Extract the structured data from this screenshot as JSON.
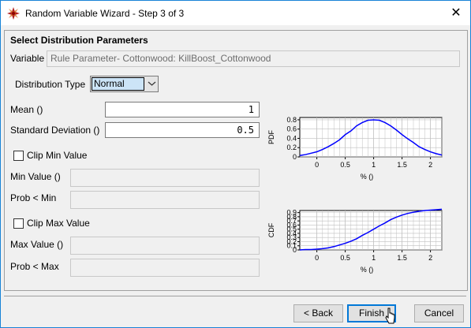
{
  "window": {
    "title": "Random Variable Wizard - Step 3 of 3",
    "close_glyph": "✕"
  },
  "section_title": "Select Distribution Parameters",
  "variable": {
    "label": "Variable",
    "value": "Rule Parameter- Cottonwood: KillBoost_Cottonwood"
  },
  "distribution_type": {
    "label": "Distribution Type",
    "selected": "Normal"
  },
  "mean": {
    "label": "Mean ()",
    "value": "1"
  },
  "std_dev": {
    "label": "Standard Deviation ()",
    "value": "0.5"
  },
  "clip_min": {
    "label": "Clip Min Value",
    "checked": false,
    "min_value_label": "Min Value ()",
    "prob_label": "Prob < Min"
  },
  "clip_max": {
    "label": "Clip Max Value",
    "checked": false,
    "max_value_label": "Max Value ()",
    "prob_label": "Prob < Max"
  },
  "buttons": {
    "back": "< Back",
    "finish": "Finish",
    "cancel": "Cancel"
  },
  "chart_data": [
    {
      "type": "line",
      "ylabel": "PDF",
      "xlabel": "% ()",
      "xlim": [
        -0.3,
        2.2
      ],
      "ylim": [
        0,
        0.85
      ],
      "x_ticks": [
        "0",
        "0.5",
        "1",
        "1.5",
        "2"
      ],
      "y_ticks": [
        "0",
        "0.2",
        "0.4",
        "0.6",
        "0.8"
      ],
      "grid": true,
      "series": [
        {
          "color": "#0000ff",
          "x": [
            -0.3,
            -0.2,
            -0.1,
            0,
            0.1,
            0.2,
            0.3,
            0.4,
            0.5,
            0.6,
            0.7,
            0.8,
            0.9,
            1,
            1.1,
            1.2,
            1.3,
            1.4,
            1.5,
            1.6,
            1.7,
            1.8,
            1.9,
            2,
            2.1,
            2.2
          ],
          "y": [
            0.03,
            0.05,
            0.08,
            0.11,
            0.16,
            0.22,
            0.29,
            0.37,
            0.48,
            0.56,
            0.67,
            0.74,
            0.79,
            0.8,
            0.79,
            0.74,
            0.67,
            0.58,
            0.48,
            0.39,
            0.31,
            0.22,
            0.16,
            0.11,
            0.07,
            0.04
          ]
        }
      ]
    },
    {
      "type": "line",
      "ylabel": "CDF",
      "xlabel": "% ()",
      "xlim": [
        -0.3,
        2.2
      ],
      "ylim": [
        0,
        0.95
      ],
      "x_ticks": [
        "0",
        "0.5",
        "1",
        "1.5",
        "2"
      ],
      "y_ticks": [
        "0",
        "0.1",
        "0.2",
        "0.3",
        "0.4",
        "0.5",
        "0.6",
        "0.7",
        "0.8",
        "0.9"
      ],
      "grid": true,
      "series": [
        {
          "color": "#0000ff",
          "x": [
            -0.3,
            -0.2,
            -0.1,
            0,
            0.1,
            0.2,
            0.3,
            0.4,
            0.5,
            0.6,
            0.7,
            0.8,
            0.9,
            1,
            1.1,
            1.2,
            1.3,
            1.4,
            1.5,
            1.6,
            1.7,
            1.8,
            1.9,
            2,
            2.1,
            2.2
          ],
          "y": [
            0.0,
            0.01,
            0.01,
            0.02,
            0.03,
            0.05,
            0.08,
            0.12,
            0.16,
            0.21,
            0.27,
            0.35,
            0.42,
            0.5,
            0.58,
            0.65,
            0.73,
            0.79,
            0.84,
            0.88,
            0.91,
            0.93,
            0.95,
            0.96,
            0.97,
            0.98
          ]
        }
      ]
    }
  ]
}
